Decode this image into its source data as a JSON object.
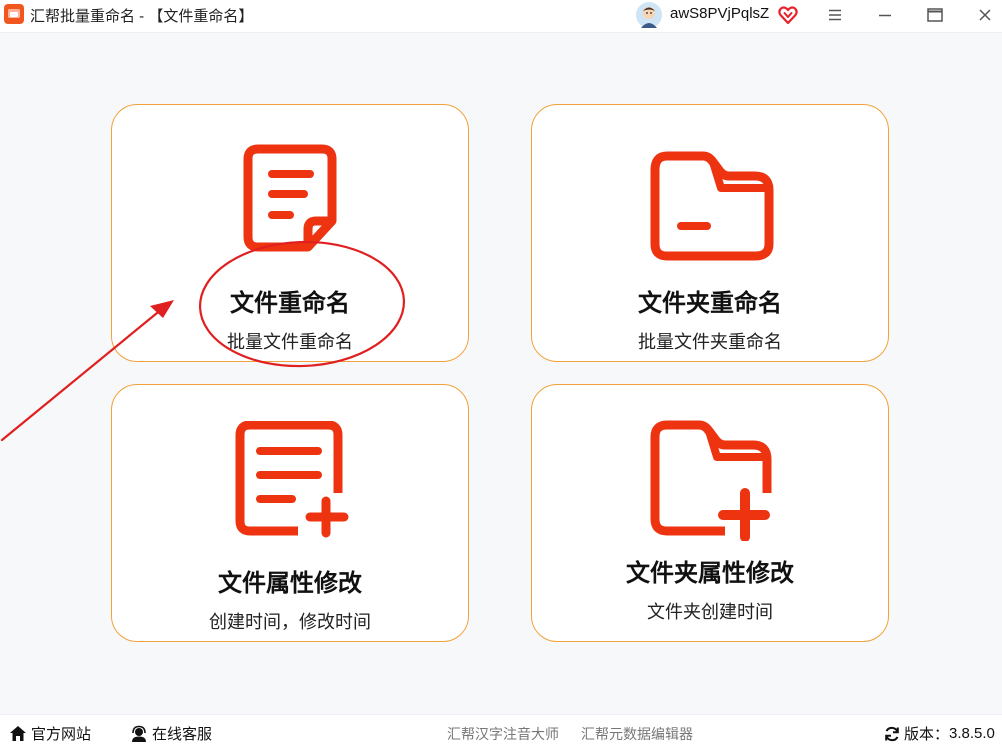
{
  "window": {
    "title": "汇帮批量重命名 - 【文件重命名】",
    "username": "awS8PVjPqlsZ",
    "icons": [
      "app-logo",
      "avatar",
      "vip-heart-icon",
      "menu-icon",
      "minimize-icon",
      "maximize-icon",
      "close-icon"
    ]
  },
  "colors": {
    "accent": "#ee3311",
    "card_border": "#f2a23a",
    "annotation": "#e02020",
    "background": "#f7f8fa"
  },
  "cards": [
    {
      "title": "文件重命名",
      "subtitle": "批量文件重命名",
      "icon": "document-icon"
    },
    {
      "title": "文件夹重命名",
      "subtitle": "批量文件夹重命名",
      "icon": "folder-icon"
    },
    {
      "title": "文件属性修改",
      "subtitle": "创建时间，修改时间",
      "icon": "document-add-icon"
    },
    {
      "title": "文件夹属性修改",
      "subtitle": "文件夹创建时间",
      "icon": "folder-add-icon"
    }
  ],
  "statusbar": {
    "home_label": "官方网站",
    "service_label": "在线客服",
    "link1": "汇帮汉字注音大师",
    "link2": "汇帮元数据编辑器",
    "version_prefix": "版本：",
    "version": "3.8.5.0"
  }
}
